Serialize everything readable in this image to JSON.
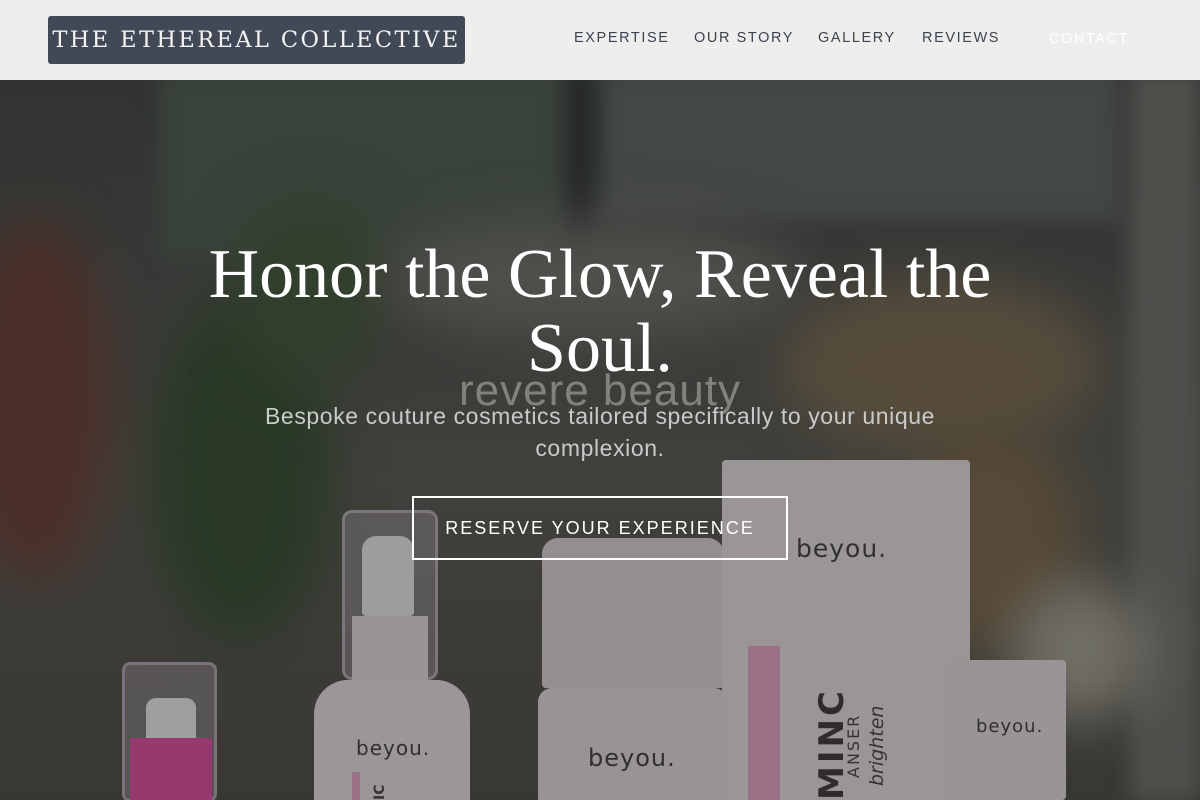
{
  "header": {
    "logo_text": "THE ETHEREAL COLLECTIVE",
    "nav": [
      {
        "label": "EXPERTISE"
      },
      {
        "label": "OUR STORY"
      },
      {
        "label": "GALLERY"
      },
      {
        "label": "REVIEWS"
      }
    ],
    "contact_label": "CONTACT"
  },
  "hero": {
    "headline": "Honor the Glow, Reveal the Soul.",
    "subhead": "Bespoke couture cosmetics tailored specifically to your unique complexion.",
    "cta_label": "RESERVE YOUR EXPERIENCE",
    "background_text": "revere beauty"
  },
  "products": {
    "brand_text": "beyou.",
    "tube_label_big": "MINC",
    "tube_label_small": "ANSER",
    "tube_label_italic": "brighten",
    "pump_label": "IC"
  },
  "colors": {
    "header_bg": "#eeeeec",
    "logo_bg": "#414957",
    "nav_text": "#3c4350",
    "accent_pink": "#e8a4c4"
  }
}
